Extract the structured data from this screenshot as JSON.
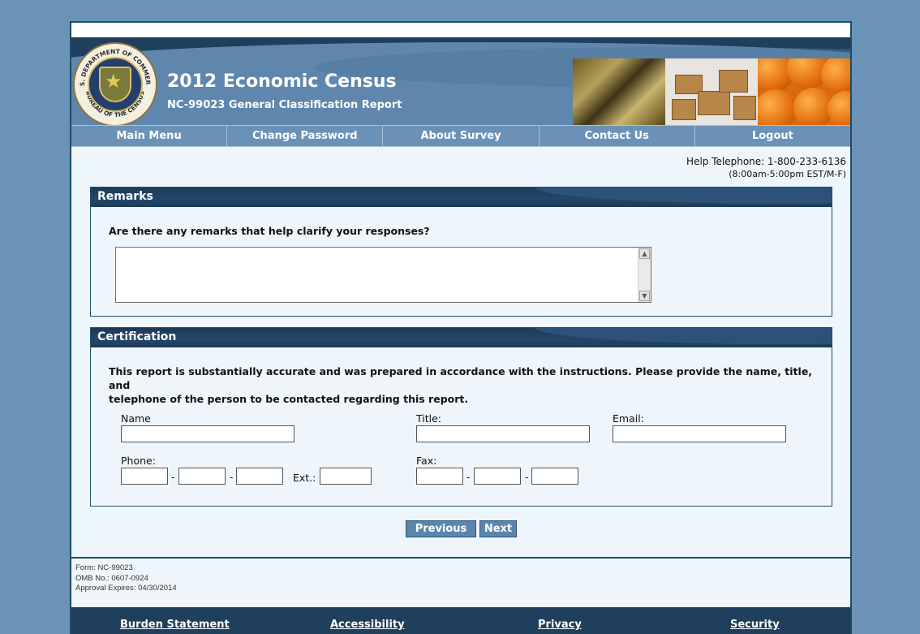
{
  "header": {
    "title": "2012 Economic Census",
    "subtitle": "NC-99023 General Classification Report",
    "seal_text_top": "U.S. DEPARTMENT OF COMMERCE",
    "seal_text_bottom": "BUREAU OF THE CENSUS"
  },
  "nav": {
    "items": [
      {
        "label": "Main Menu"
      },
      {
        "label": "Change Password"
      },
      {
        "label": "About Survey"
      },
      {
        "label": "Contact Us"
      },
      {
        "label": "Logout"
      }
    ]
  },
  "help": {
    "phone": "Help Telephone: 1-800-233-6136",
    "hours": "(8:00am-5:00pm EST/M-F)"
  },
  "remarks": {
    "title": "Remarks",
    "question": "Are there any remarks that help clarify your responses?",
    "value": ""
  },
  "certification": {
    "title": "Certification",
    "statement_line1": "This report is substantially accurate and was prepared in accordance with the instructions. Please provide the name, title, and",
    "statement_line2": "telephone of the person to be contacted regarding this report.",
    "name_label": "Name",
    "title_label": "Title:",
    "email_label": "Email:",
    "phone_label": "Phone:",
    "ext_label": "Ext.:",
    "fax_label": "Fax:",
    "dash": "-"
  },
  "buttons": {
    "previous": "Previous",
    "next": "Next"
  },
  "form_meta": {
    "form": "Form: NC-99023",
    "omb": "OMB No.: 0607-0924",
    "expires": "Approval Expires: 04/30/2014"
  },
  "footer": {
    "links": [
      {
        "label": "Burden Statement"
      },
      {
        "label": "Accessibility"
      },
      {
        "label": "Privacy"
      },
      {
        "label": "Security"
      }
    ]
  },
  "colors": {
    "banner": "#5f87ad",
    "nav": "#6a92b9",
    "panel_header": "#1c3a56",
    "button": "#5a86ae",
    "page_bg": "#eef5fb",
    "outer_bg": "#6b93b7"
  }
}
